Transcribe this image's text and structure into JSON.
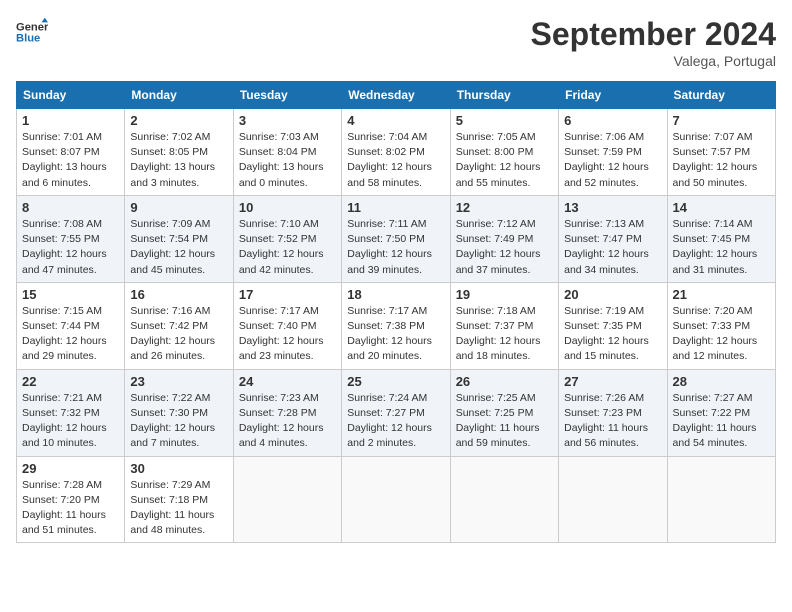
{
  "header": {
    "logo_line1": "General",
    "logo_line2": "Blue",
    "month": "September 2024",
    "location": "Valega, Portugal"
  },
  "weekdays": [
    "Sunday",
    "Monday",
    "Tuesday",
    "Wednesday",
    "Thursday",
    "Friday",
    "Saturday"
  ],
  "weeks": [
    [
      {
        "day": "1",
        "sunrise": "7:01 AM",
        "sunset": "8:07 PM",
        "daylight": "13 hours and 6 minutes."
      },
      {
        "day": "2",
        "sunrise": "7:02 AM",
        "sunset": "8:05 PM",
        "daylight": "13 hours and 3 minutes."
      },
      {
        "day": "3",
        "sunrise": "7:03 AM",
        "sunset": "8:04 PM",
        "daylight": "13 hours and 0 minutes."
      },
      {
        "day": "4",
        "sunrise": "7:04 AM",
        "sunset": "8:02 PM",
        "daylight": "12 hours and 58 minutes."
      },
      {
        "day": "5",
        "sunrise": "7:05 AM",
        "sunset": "8:00 PM",
        "daylight": "12 hours and 55 minutes."
      },
      {
        "day": "6",
        "sunrise": "7:06 AM",
        "sunset": "7:59 PM",
        "daylight": "12 hours and 52 minutes."
      },
      {
        "day": "7",
        "sunrise": "7:07 AM",
        "sunset": "7:57 PM",
        "daylight": "12 hours and 50 minutes."
      }
    ],
    [
      {
        "day": "8",
        "sunrise": "7:08 AM",
        "sunset": "7:55 PM",
        "daylight": "12 hours and 47 minutes."
      },
      {
        "day": "9",
        "sunrise": "7:09 AM",
        "sunset": "7:54 PM",
        "daylight": "12 hours and 45 minutes."
      },
      {
        "day": "10",
        "sunrise": "7:10 AM",
        "sunset": "7:52 PM",
        "daylight": "12 hours and 42 minutes."
      },
      {
        "day": "11",
        "sunrise": "7:11 AM",
        "sunset": "7:50 PM",
        "daylight": "12 hours and 39 minutes."
      },
      {
        "day": "12",
        "sunrise": "7:12 AM",
        "sunset": "7:49 PM",
        "daylight": "12 hours and 37 minutes."
      },
      {
        "day": "13",
        "sunrise": "7:13 AM",
        "sunset": "7:47 PM",
        "daylight": "12 hours and 34 minutes."
      },
      {
        "day": "14",
        "sunrise": "7:14 AM",
        "sunset": "7:45 PM",
        "daylight": "12 hours and 31 minutes."
      }
    ],
    [
      {
        "day": "15",
        "sunrise": "7:15 AM",
        "sunset": "7:44 PM",
        "daylight": "12 hours and 29 minutes."
      },
      {
        "day": "16",
        "sunrise": "7:16 AM",
        "sunset": "7:42 PM",
        "daylight": "12 hours and 26 minutes."
      },
      {
        "day": "17",
        "sunrise": "7:17 AM",
        "sunset": "7:40 PM",
        "daylight": "12 hours and 23 minutes."
      },
      {
        "day": "18",
        "sunrise": "7:17 AM",
        "sunset": "7:38 PM",
        "daylight": "12 hours and 20 minutes."
      },
      {
        "day": "19",
        "sunrise": "7:18 AM",
        "sunset": "7:37 PM",
        "daylight": "12 hours and 18 minutes."
      },
      {
        "day": "20",
        "sunrise": "7:19 AM",
        "sunset": "7:35 PM",
        "daylight": "12 hours and 15 minutes."
      },
      {
        "day": "21",
        "sunrise": "7:20 AM",
        "sunset": "7:33 PM",
        "daylight": "12 hours and 12 minutes."
      }
    ],
    [
      {
        "day": "22",
        "sunrise": "7:21 AM",
        "sunset": "7:32 PM",
        "daylight": "12 hours and 10 minutes."
      },
      {
        "day": "23",
        "sunrise": "7:22 AM",
        "sunset": "7:30 PM",
        "daylight": "12 hours and 7 minutes."
      },
      {
        "day": "24",
        "sunrise": "7:23 AM",
        "sunset": "7:28 PM",
        "daylight": "12 hours and 4 minutes."
      },
      {
        "day": "25",
        "sunrise": "7:24 AM",
        "sunset": "7:27 PM",
        "daylight": "12 hours and 2 minutes."
      },
      {
        "day": "26",
        "sunrise": "7:25 AM",
        "sunset": "7:25 PM",
        "daylight": "11 hours and 59 minutes."
      },
      {
        "day": "27",
        "sunrise": "7:26 AM",
        "sunset": "7:23 PM",
        "daylight": "11 hours and 56 minutes."
      },
      {
        "day": "28",
        "sunrise": "7:27 AM",
        "sunset": "7:22 PM",
        "daylight": "11 hours and 54 minutes."
      }
    ],
    [
      {
        "day": "29",
        "sunrise": "7:28 AM",
        "sunset": "7:20 PM",
        "daylight": "11 hours and 51 minutes."
      },
      {
        "day": "30",
        "sunrise": "7:29 AM",
        "sunset": "7:18 PM",
        "daylight": "11 hours and 48 minutes."
      },
      null,
      null,
      null,
      null,
      null
    ]
  ]
}
